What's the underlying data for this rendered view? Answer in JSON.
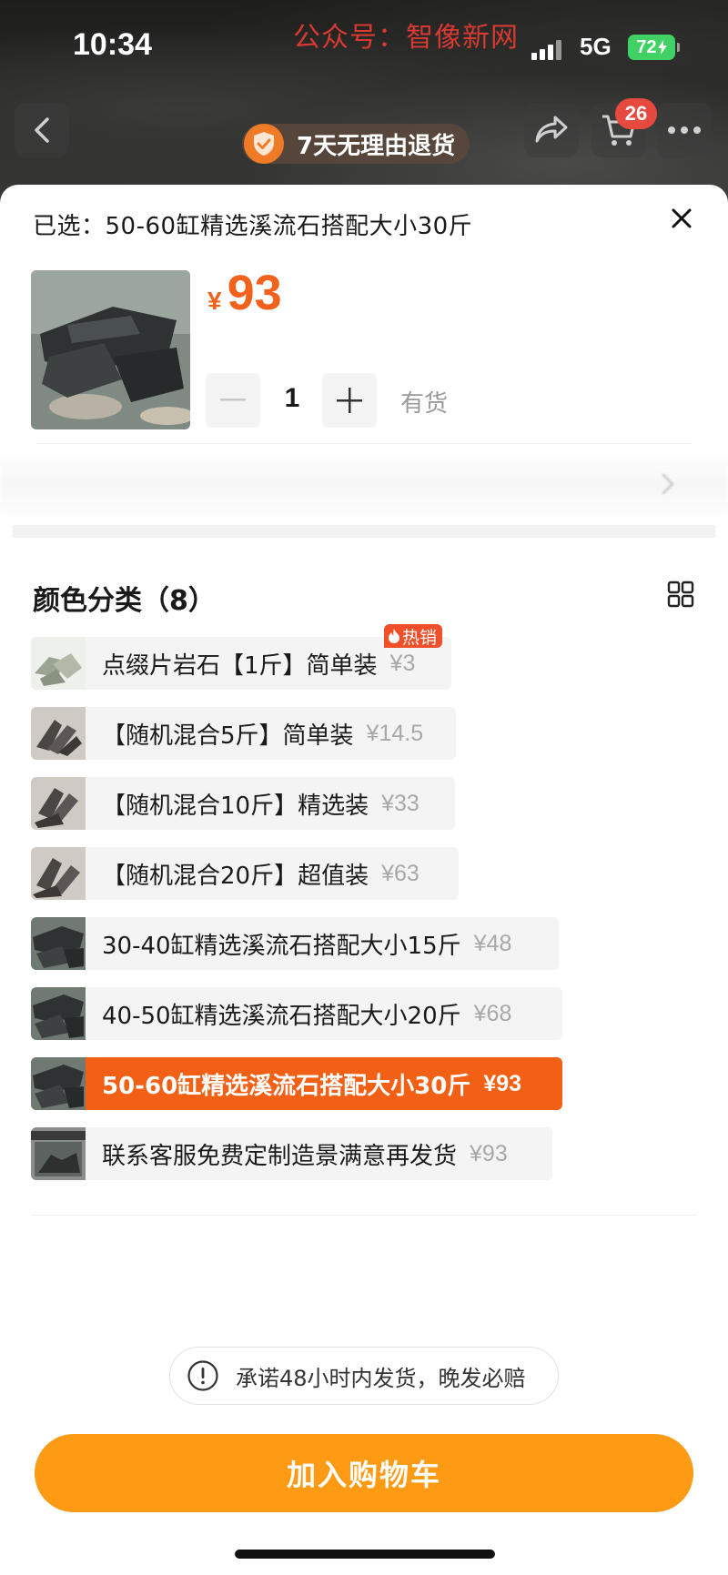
{
  "status_bar": {
    "time": "10:34",
    "network": "5G",
    "battery": "72"
  },
  "watermark": "公众号：智像新网",
  "nav": {
    "return_policy": "7天无理由退货",
    "cart_count": "26"
  },
  "sheet": {
    "selected_label": "已选：",
    "selected_value": "50-60缸精选溪流石搭配大小30斤",
    "price_currency": "¥",
    "price": "93",
    "quantity": "1",
    "stock_status": "有货"
  },
  "options_section": {
    "title": "颜色分类（8）",
    "items": [
      {
        "label": "点缀片岩石【1斤】简单装",
        "price": "¥3",
        "badge": "热销",
        "selected": false
      },
      {
        "label": "【随机混合5斤】简单装",
        "price": "¥14.5",
        "selected": false
      },
      {
        "label": "【随机混合10斤】精选装",
        "price": "¥33",
        "selected": false
      },
      {
        "label": "【随机混合20斤】超值装",
        "price": "¥63",
        "selected": false
      },
      {
        "label": "30-40缸精选溪流石搭配大小15斤",
        "price": "¥48",
        "selected": false
      },
      {
        "label": "40-50缸精选溪流石搭配大小20斤",
        "price": "¥68",
        "selected": false
      },
      {
        "label": "50-60缸精选溪流石搭配大小30斤",
        "price": "¥93",
        "selected": true
      },
      {
        "label": "联系客服免费定制造景满意再发货",
        "price": "¥93",
        "selected": false
      }
    ]
  },
  "promise": {
    "text": "承诺48小时内发货，晚发必赔"
  },
  "add_to_cart": {
    "label": "加入购物车"
  },
  "colors": {
    "accent_orange": "#f26016",
    "price_orange": "#f2621d",
    "button_orange": "#ff9a14",
    "badge_red": "#e6493e"
  }
}
